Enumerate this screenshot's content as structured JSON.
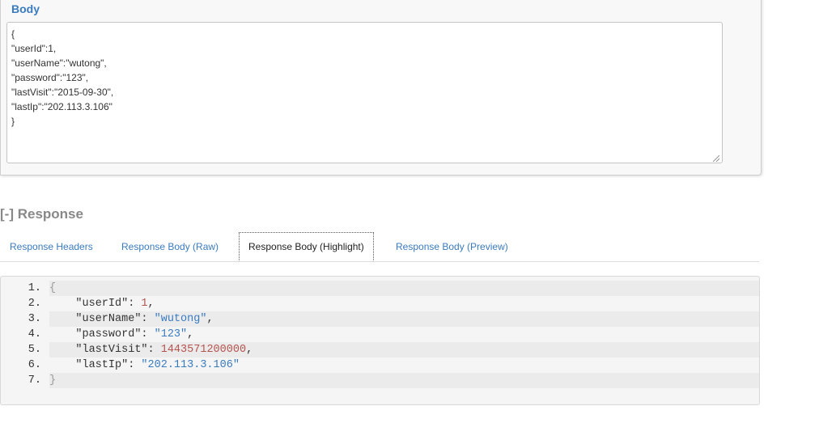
{
  "body_section": {
    "label": "Body",
    "text": "{\n\"userId\":1,\n\"userName\":\"wutong\",\n\"password\":\"123\",\n\"lastVisit\":\"2015-09-30\",\n\"lastIp\":\"202.113.3.106\"\n}"
  },
  "response": {
    "toggle": "[-]",
    "title": "Response",
    "tabs": [
      {
        "label": "Response Headers",
        "active": false
      },
      {
        "label": "Response Body (Raw)",
        "active": false
      },
      {
        "label": "Response Body (Highlight)",
        "active": true
      },
      {
        "label": "Response Body (Preview)",
        "active": false
      }
    ],
    "code_lines": [
      {
        "num": "1.",
        "indent": "",
        "key": "",
        "sep": "",
        "value": "",
        "value_type": "",
        "tail": "{"
      },
      {
        "num": "2.",
        "indent": "    ",
        "key": "\"userId\"",
        "sep": ": ",
        "value": "1",
        "value_type": "number",
        "tail": ","
      },
      {
        "num": "3.",
        "indent": "    ",
        "key": "\"userName\"",
        "sep": ": ",
        "value": "\"wutong\"",
        "value_type": "string",
        "tail": ","
      },
      {
        "num": "4.",
        "indent": "    ",
        "key": "\"password\"",
        "sep": ": ",
        "value": "\"123\"",
        "value_type": "string",
        "tail": ","
      },
      {
        "num": "5.",
        "indent": "    ",
        "key": "\"lastVisit\"",
        "sep": ": ",
        "value": "1443571200000",
        "value_type": "number",
        "tail": ","
      },
      {
        "num": "6.",
        "indent": "    ",
        "key": "\"lastIp\"",
        "sep": ": ",
        "value": "\"202.113.3.106\"",
        "value_type": "string",
        "tail": ""
      },
      {
        "num": "7.",
        "indent": "",
        "key": "",
        "sep": "",
        "value": "",
        "value_type": "",
        "tail": "}"
      }
    ]
  },
  "colors": {
    "link": "#3a7bbf",
    "number": "#b5534f",
    "string": "#3a7bbf",
    "punctuation": "#999999"
  }
}
